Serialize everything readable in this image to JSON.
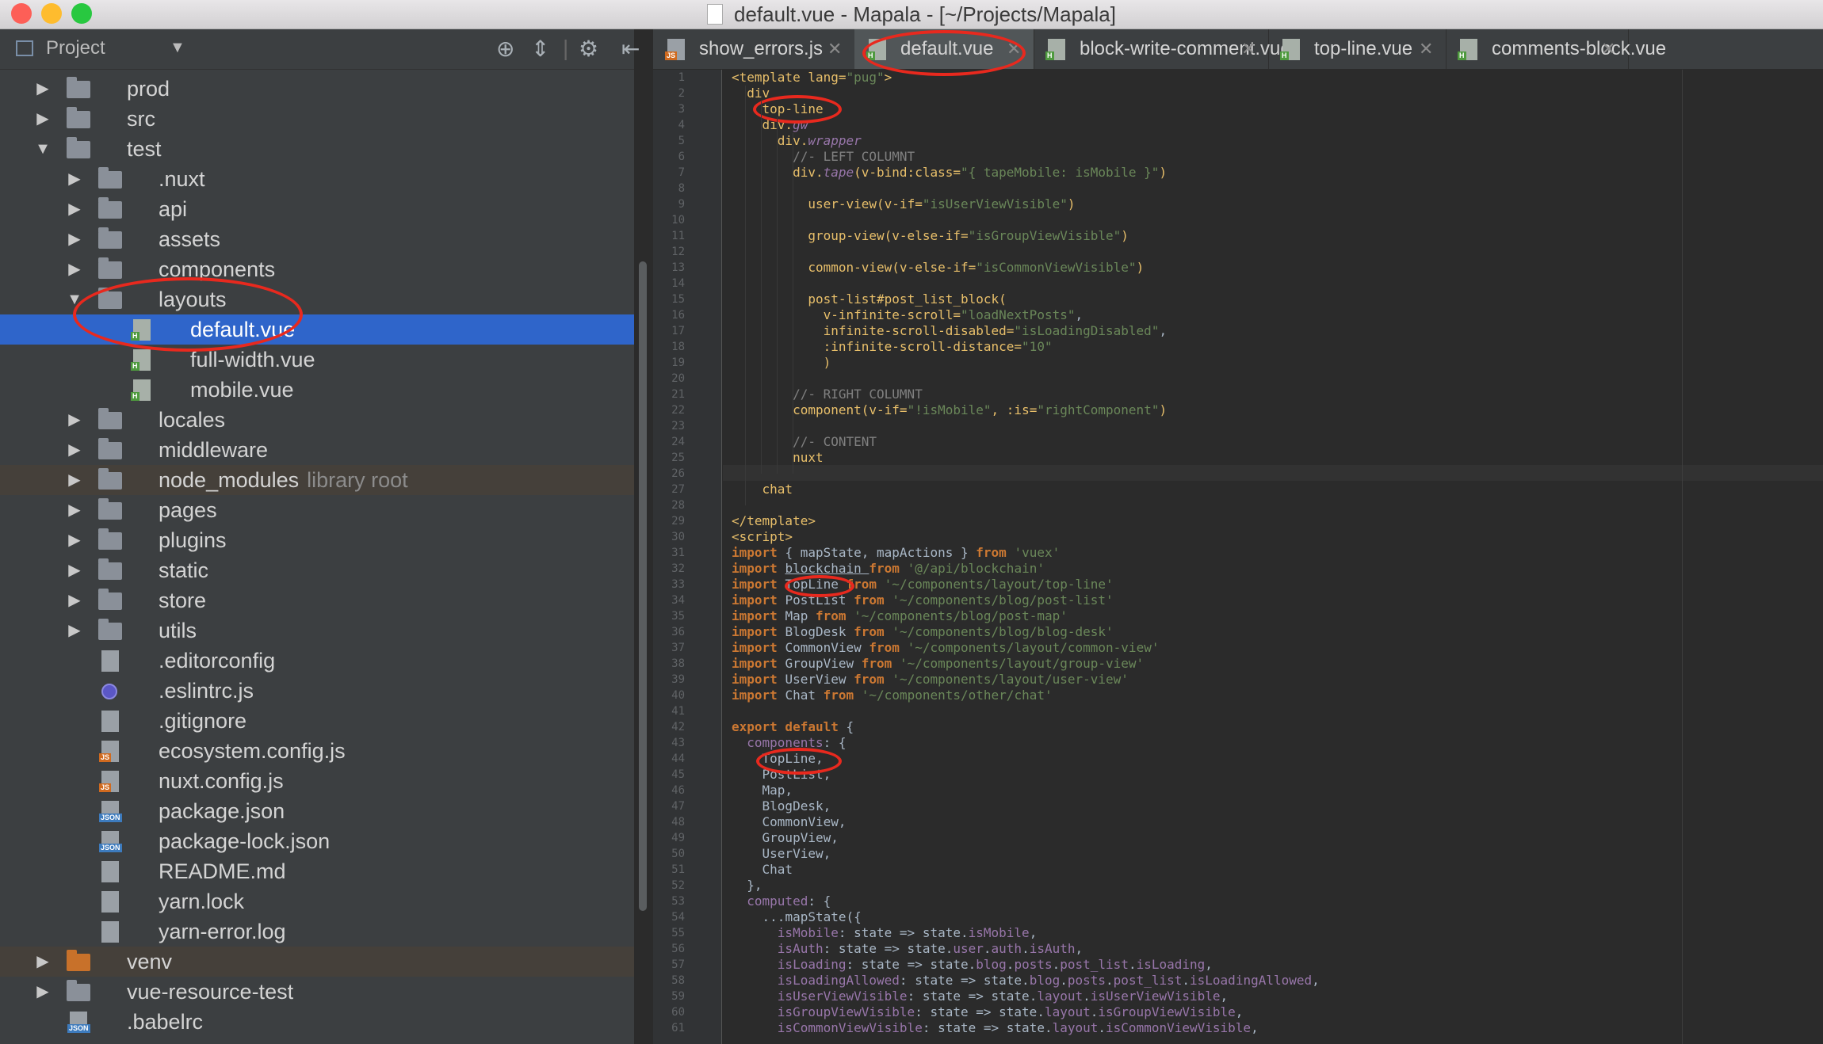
{
  "window": {
    "title": "default.vue - Mapala - [~/Projects/Mapala]",
    "traffic_lights": [
      "#fd5f57",
      "#febc2e",
      "#28c840"
    ]
  },
  "sidebar": {
    "title": "Project",
    "header_icons": [
      "target-icon",
      "collapse-icon",
      "gear-icon",
      "hide-icon"
    ],
    "tree": [
      {
        "label": "prod",
        "type": "folder",
        "depth": 0,
        "expanded": false
      },
      {
        "label": "src",
        "type": "folder",
        "depth": 0,
        "expanded": false
      },
      {
        "label": "test",
        "type": "folder",
        "depth": 0,
        "expanded": true
      },
      {
        "label": ".nuxt",
        "type": "folder",
        "depth": 1,
        "expanded": false
      },
      {
        "label": "api",
        "type": "folder",
        "depth": 1,
        "expanded": false
      },
      {
        "label": "assets",
        "type": "folder",
        "depth": 1,
        "expanded": false
      },
      {
        "label": "components",
        "type": "folder",
        "depth": 1,
        "expanded": false
      },
      {
        "label": "layouts",
        "type": "folder",
        "depth": 1,
        "expanded": true
      },
      {
        "label": "default.vue",
        "type": "vue",
        "depth": 2,
        "selected": true
      },
      {
        "label": "full-width.vue",
        "type": "vue",
        "depth": 2
      },
      {
        "label": "mobile.vue",
        "type": "vue",
        "depth": 2
      },
      {
        "label": "locales",
        "type": "folder",
        "depth": 1,
        "expanded": false
      },
      {
        "label": "middleware",
        "type": "folder",
        "depth": 1,
        "expanded": false
      },
      {
        "label": "node_modules",
        "type": "folder",
        "depth": 1,
        "expanded": false,
        "suffix": "library root",
        "highlight": true
      },
      {
        "label": "pages",
        "type": "folder",
        "depth": 1,
        "expanded": false
      },
      {
        "label": "plugins",
        "type": "folder",
        "depth": 1,
        "expanded": false
      },
      {
        "label": "static",
        "type": "folder",
        "depth": 1,
        "expanded": false
      },
      {
        "label": "store",
        "type": "folder",
        "depth": 1,
        "expanded": false
      },
      {
        "label": "utils",
        "type": "folder",
        "depth": 1,
        "expanded": false
      },
      {
        "label": ".editorconfig",
        "type": "file",
        "depth": 1
      },
      {
        "label": ".eslintrc.js",
        "type": "eslint",
        "depth": 1
      },
      {
        "label": ".gitignore",
        "type": "file",
        "depth": 1
      },
      {
        "label": "ecosystem.config.js",
        "type": "js",
        "depth": 1
      },
      {
        "label": "nuxt.config.js",
        "type": "js",
        "depth": 1
      },
      {
        "label": "package.json",
        "type": "json",
        "depth": 1
      },
      {
        "label": "package-lock.json",
        "type": "json",
        "depth": 1
      },
      {
        "label": "README.md",
        "type": "file",
        "depth": 1
      },
      {
        "label": "yarn.lock",
        "type": "file",
        "depth": 1
      },
      {
        "label": "yarn-error.log",
        "type": "file",
        "depth": 1
      },
      {
        "label": "venv",
        "type": "folder-orange",
        "depth": 0,
        "expanded": false,
        "highlight": true
      },
      {
        "label": "vue-resource-test",
        "type": "folder",
        "depth": 0,
        "expanded": false
      },
      {
        "label": ".babelrc",
        "type": "json",
        "depth": 0
      }
    ]
  },
  "tabs": [
    {
      "label": "show_errors.js",
      "type": "js",
      "active": false
    },
    {
      "label": "default.vue",
      "type": "vue",
      "active": true
    },
    {
      "label": "block-write-comment.vue",
      "type": "vue",
      "active": false
    },
    {
      "label": "top-line.vue",
      "type": "vue",
      "active": false
    },
    {
      "label": "comments-block.vue",
      "type": "vue",
      "active": false
    }
  ],
  "editor": {
    "current_line": 26,
    "lines": [
      [
        [
          "<template ",
          "tg"
        ],
        [
          "lang=",
          "tg"
        ],
        [
          "\"pug\"",
          "str"
        ],
        [
          ">",
          "tg"
        ]
      ],
      [
        [
          "  div",
          "tg"
        ]
      ],
      [
        [
          "    top-line",
          "tg"
        ]
      ],
      [
        [
          "    div.",
          "tg"
        ],
        [
          "gw",
          "it"
        ]
      ],
      [
        [
          "      div.",
          "tg"
        ],
        [
          "wrapper",
          "it"
        ]
      ],
      [
        [
          "        //- LEFT COLUMNT",
          "cm"
        ]
      ],
      [
        [
          "        div.",
          "tg"
        ],
        [
          "tape",
          "it"
        ],
        [
          "(v-bind:class=",
          "tg"
        ],
        [
          "\"{ tapeMobile: isMobile }\"",
          "str"
        ],
        [
          ")",
          "tg"
        ]
      ],
      [
        [
          "",
          ""
        ]
      ],
      [
        [
          "          user-view",
          "tg"
        ],
        [
          "(v-if=",
          "tg"
        ],
        [
          "\"isUserViewVisible\"",
          "str"
        ],
        [
          ")",
          "tg"
        ]
      ],
      [
        [
          "",
          ""
        ]
      ],
      [
        [
          "          group-view",
          "tg"
        ],
        [
          "(v-else-if=",
          "tg"
        ],
        [
          "\"isGroupViewVisible\"",
          "str"
        ],
        [
          ")",
          "tg"
        ]
      ],
      [
        [
          "",
          ""
        ]
      ],
      [
        [
          "          common-view",
          "tg"
        ],
        [
          "(v-else-if=",
          "tg"
        ],
        [
          "\"isCommonViewVisible\"",
          "str"
        ],
        [
          ")",
          "tg"
        ]
      ],
      [
        [
          "",
          ""
        ]
      ],
      [
        [
          "          post-list",
          "tg"
        ],
        [
          "#post_list_block(",
          "tg"
        ]
      ],
      [
        [
          "            v-infinite-scroll=",
          "tg"
        ],
        [
          "\"loadNextPosts\"",
          "str"
        ],
        [
          ",",
          ""
        ]
      ],
      [
        [
          "            infinite-scroll-disabled=",
          "tg"
        ],
        [
          "\"isLoadingDisabled\"",
          "str"
        ],
        [
          ",",
          ""
        ]
      ],
      [
        [
          "            :infinite-scroll-distance=",
          "tg"
        ],
        [
          "\"10\"",
          "str"
        ]
      ],
      [
        [
          "            )",
          "tg"
        ]
      ],
      [
        [
          "",
          ""
        ]
      ],
      [
        [
          "        //- RIGHT COLUMNT",
          "cm"
        ]
      ],
      [
        [
          "        component",
          "tg"
        ],
        [
          "(v-if=",
          "tg"
        ],
        [
          "\"!isMobile\"",
          "str"
        ],
        [
          ", :is=",
          "tg"
        ],
        [
          "\"rightComponent\"",
          "str"
        ],
        [
          ")",
          "tg"
        ]
      ],
      [
        [
          "",
          ""
        ]
      ],
      [
        [
          "        //- CONTENT",
          "cm"
        ]
      ],
      [
        [
          "        nuxt",
          "tg"
        ]
      ],
      [
        [
          "",
          ""
        ]
      ],
      [
        [
          "    chat",
          "tg"
        ]
      ],
      [
        [
          "",
          ""
        ]
      ],
      [
        [
          "</template>",
          "tg"
        ]
      ],
      [
        [
          "<script>",
          "tg"
        ]
      ],
      [
        [
          "import ",
          "kw"
        ],
        [
          "{ mapState, mapActions } ",
          ""
        ],
        [
          "from ",
          "kw"
        ],
        [
          "'vuex'",
          "str"
        ]
      ],
      [
        [
          "import ",
          "kw"
        ],
        [
          "blockchain ",
          "ul"
        ],
        [
          "from ",
          "kw"
        ],
        [
          "'@/api/blockchain'",
          "str"
        ]
      ],
      [
        [
          "import ",
          "kw"
        ],
        [
          "TopLine ",
          ""
        ],
        [
          "from ",
          "kw"
        ],
        [
          "'~/components/layout/top-line'",
          "str"
        ]
      ],
      [
        [
          "import ",
          "kw"
        ],
        [
          "PostList ",
          ""
        ],
        [
          "from ",
          "kw"
        ],
        [
          "'~/components/blog/post-list'",
          "str"
        ]
      ],
      [
        [
          "import ",
          "kw"
        ],
        [
          "Map ",
          ""
        ],
        [
          "from ",
          "kw"
        ],
        [
          "'~/components/blog/post-map'",
          "str"
        ]
      ],
      [
        [
          "import ",
          "kw"
        ],
        [
          "BlogDesk ",
          ""
        ],
        [
          "from ",
          "kw"
        ],
        [
          "'~/components/blog/blog-desk'",
          "str"
        ]
      ],
      [
        [
          "import ",
          "kw"
        ],
        [
          "CommonView ",
          ""
        ],
        [
          "from ",
          "kw"
        ],
        [
          "'~/components/layout/common-view'",
          "str"
        ]
      ],
      [
        [
          "import ",
          "kw"
        ],
        [
          "GroupView ",
          ""
        ],
        [
          "from ",
          "kw"
        ],
        [
          "'~/components/layout/group-view'",
          "str"
        ]
      ],
      [
        [
          "import ",
          "kw"
        ],
        [
          "UserView ",
          ""
        ],
        [
          "from ",
          "kw"
        ],
        [
          "'~/components/layout/user-view'",
          "str"
        ]
      ],
      [
        [
          "import ",
          "kw"
        ],
        [
          "Chat ",
          ""
        ],
        [
          "from ",
          "kw"
        ],
        [
          "'~/components/other/chat'",
          "str"
        ]
      ],
      [
        [
          "",
          ""
        ]
      ],
      [
        [
          "export default ",
          "kw"
        ],
        [
          "{",
          ""
        ]
      ],
      [
        [
          "  components",
          "pv"
        ],
        [
          ": {",
          ""
        ]
      ],
      [
        [
          "    TopLine,",
          ""
        ]
      ],
      [
        [
          "    PostList,",
          ""
        ]
      ],
      [
        [
          "    Map,",
          ""
        ]
      ],
      [
        [
          "    BlogDesk,",
          ""
        ]
      ],
      [
        [
          "    CommonView,",
          ""
        ]
      ],
      [
        [
          "    GroupView,",
          ""
        ]
      ],
      [
        [
          "    UserView,",
          ""
        ]
      ],
      [
        [
          "    Chat",
          ""
        ]
      ],
      [
        [
          "  },",
          ""
        ]
      ],
      [
        [
          "  computed",
          "pv"
        ],
        [
          ": {",
          ""
        ]
      ],
      [
        [
          "    ...",
          ""
        ],
        [
          "mapState",
          ""
        ],
        [
          "({",
          ""
        ]
      ],
      [
        [
          "      isMobile",
          "pv"
        ],
        [
          ": state => state.",
          ""
        ],
        [
          "isMobile",
          "pv"
        ],
        [
          ",",
          ""
        ]
      ],
      [
        [
          "      isAuth",
          "pv"
        ],
        [
          ": state => state.",
          ""
        ],
        [
          "user",
          "pv"
        ],
        [
          ".",
          ""
        ],
        [
          "auth",
          "pv"
        ],
        [
          ".",
          ""
        ],
        [
          "isAuth",
          "pv"
        ],
        [
          ",",
          ""
        ]
      ],
      [
        [
          "      isLoading",
          "pv"
        ],
        [
          ": state => state.",
          ""
        ],
        [
          "blog",
          "pv"
        ],
        [
          ".",
          ""
        ],
        [
          "posts",
          "pv"
        ],
        [
          ".",
          ""
        ],
        [
          "post_list",
          "pv"
        ],
        [
          ".",
          ""
        ],
        [
          "isLoading",
          "pv"
        ],
        [
          ",",
          ""
        ]
      ],
      [
        [
          "      isLoadingAllowed",
          "pv"
        ],
        [
          ": state => state.",
          ""
        ],
        [
          "blog",
          "pv"
        ],
        [
          ".",
          ""
        ],
        [
          "posts",
          "pv"
        ],
        [
          ".",
          ""
        ],
        [
          "post_list",
          "pv"
        ],
        [
          ".",
          ""
        ],
        [
          "isLoadingAllowed",
          "pv"
        ],
        [
          ",",
          ""
        ]
      ],
      [
        [
          "      isUserViewVisible",
          "pv"
        ],
        [
          ": state => state.",
          ""
        ],
        [
          "layout",
          "pv"
        ],
        [
          ".",
          ""
        ],
        [
          "isUserViewVisible",
          "pv"
        ],
        [
          ",",
          ""
        ]
      ],
      [
        [
          "      isGroupViewVisible",
          "pv"
        ],
        [
          ": state => state.",
          ""
        ],
        [
          "layout",
          "pv"
        ],
        [
          ".",
          ""
        ],
        [
          "isGroupViewVisible",
          "pv"
        ],
        [
          ",",
          ""
        ]
      ],
      [
        [
          "      isCommonViewVisible",
          "pv"
        ],
        [
          ": state => state.",
          ""
        ],
        [
          "layout",
          "pv"
        ],
        [
          ".",
          ""
        ],
        [
          "isCommonViewVisible",
          "pv"
        ],
        [
          ",",
          ""
        ]
      ]
    ]
  },
  "annotations": [
    "default.vue",
    "top-line",
    "TopLine",
    "TopLine,",
    "default.vue"
  ]
}
